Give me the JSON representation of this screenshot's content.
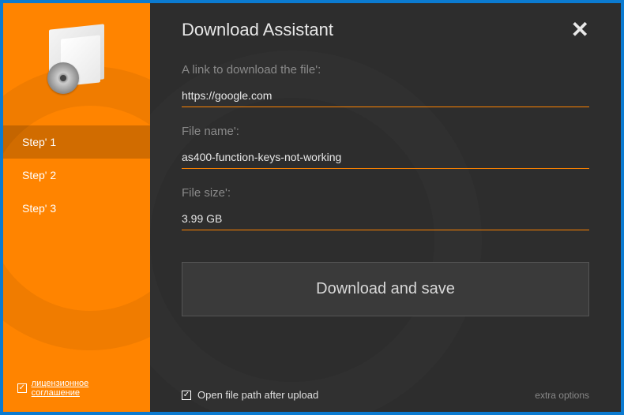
{
  "header": {
    "title": "Download Assistant"
  },
  "sidebar": {
    "steps": [
      {
        "label": "Step' 1",
        "active": true
      },
      {
        "label": "Step' 2",
        "active": false
      },
      {
        "label": "Step' 3",
        "active": false
      }
    ],
    "license": {
      "checked": true,
      "label": "лицензионное соглашение"
    }
  },
  "form": {
    "link_label": "A link to download the file':",
    "link_value": "https://google.com",
    "name_label": "File name':",
    "name_value": "as400-function-keys-not-working",
    "size_label": "File size':",
    "size_value": "3.99 GB",
    "download_label": "Download and save"
  },
  "footer": {
    "open_path_checked": true,
    "open_path_label": "Open file path after upload",
    "extra_options": "extra options"
  }
}
